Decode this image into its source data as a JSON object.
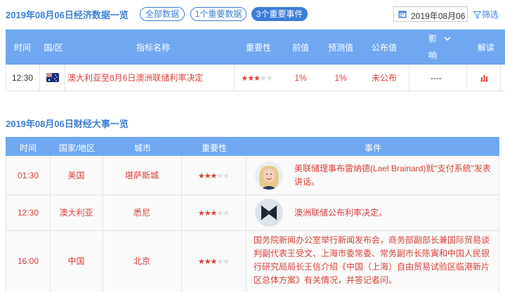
{
  "header": {
    "title": "2019年08月06日经济数据一览",
    "filters": [
      "全部数据",
      "1个重要数据",
      "3个重要事件"
    ],
    "active_filter_index": 2,
    "date_value": "2019年08月06",
    "filter_label": "筛选"
  },
  "data_table": {
    "columns": [
      "时间",
      "国/区",
      "指标名称",
      "重要性",
      "前值",
      "预测值",
      "公布值",
      "影",
      "响",
      "解读"
    ],
    "rows": [
      {
        "time": "12:30",
        "country_flag": "australia-flag",
        "indicator": "澳大利亚至8月6日澳洲联储利率决定",
        "importance": 3,
        "previous": "1%",
        "forecast": "1%",
        "actual": "未公布",
        "impact": "----",
        "analysis_icon": "bar-chart-icon"
      }
    ]
  },
  "events_section": {
    "title": "2019年08月06日财经大事一览",
    "columns": [
      "时间",
      "国家/地区",
      "城市",
      "重要性",
      "事件"
    ],
    "rows": [
      {
        "time": "01:30",
        "country": "美国",
        "city": "堪萨斯城",
        "importance": 3,
        "avatar": "person-avatar",
        "event": "美联储理事布雷纳德(Lael Brainard)就\"支付系统\"发表讲话。"
      },
      {
        "time": "12:30",
        "country": "澳大利亚",
        "city": "悉尼",
        "importance": 3,
        "avatar": "rba-logo",
        "event": "澳洲联储公布利率决定。"
      },
      {
        "time": "16:00",
        "country": "中国",
        "city": "北京",
        "importance": 3,
        "avatar": "",
        "event": "国务院新闻办公室举行新闻发布会，商务部副部长兼国际贸易谈判副代表王受文、上海市委常委、常务副市长陈寅和中国人民银行研究局局长王信介绍《中国（上海）自由贸易试验区临港新片区总体方案》有关情况，并答记者问。"
      }
    ]
  },
  "colors": {
    "accent": "#3c7fd6",
    "header_bg": "#6fa8f0",
    "red": "#d9403a"
  }
}
